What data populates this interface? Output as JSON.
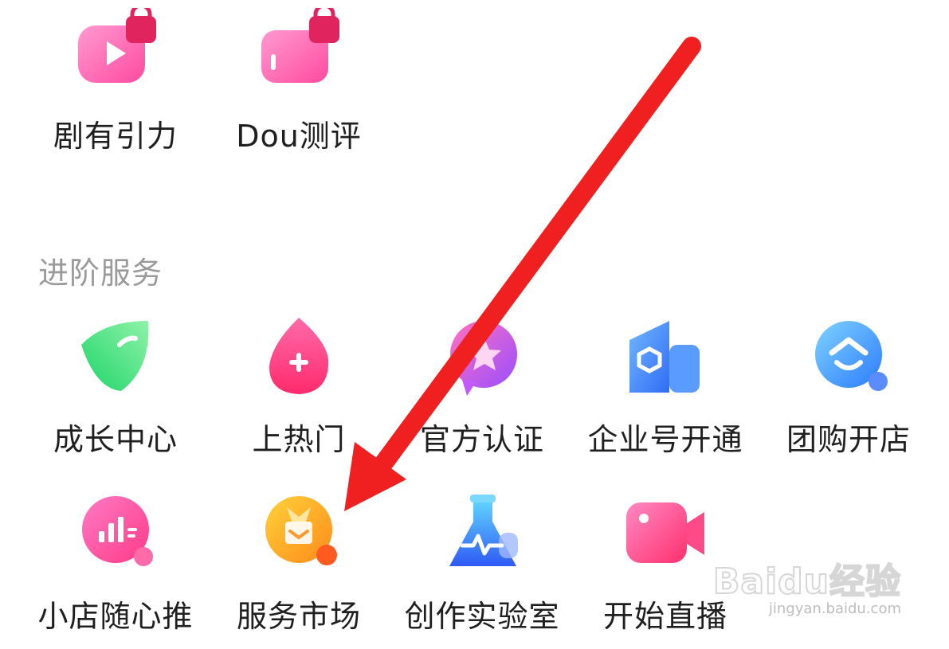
{
  "top_row": [
    {
      "label": "剧有引力",
      "icon": "tv-lock-icon"
    },
    {
      "label": "Dou测评",
      "icon": "box-lock-icon"
    }
  ],
  "section_title": "进阶服务",
  "advanced_row1": [
    {
      "label": "成长中心",
      "icon": "leaf-icon"
    },
    {
      "label": "上热门",
      "icon": "flame-plus-icon"
    },
    {
      "label": "官方认证",
      "icon": "star-badge-icon"
    },
    {
      "label": "企业号开通",
      "icon": "building-icon"
    },
    {
      "label": "团购开店",
      "icon": "house-smile-icon"
    }
  ],
  "advanced_row2": [
    {
      "label": "小店随心推",
      "icon": "cart-boost-icon"
    },
    {
      "label": "服务市场",
      "icon": "shop-bag-icon"
    },
    {
      "label": "创作实验室",
      "icon": "flask-icon"
    },
    {
      "label": "开始直播",
      "icon": "video-camera-icon"
    }
  ],
  "watermark": {
    "brand": "Baidu经验",
    "url": "jingyan.baidu.com"
  },
  "colors": {
    "arrow": "#f02020",
    "label": "#1f1f1f",
    "section": "#9a9a9a"
  }
}
